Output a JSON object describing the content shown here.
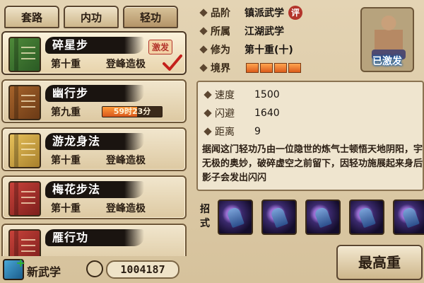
{
  "tabs": [
    {
      "label": "套路"
    },
    {
      "label": "内功"
    },
    {
      "label": "轻功"
    }
  ],
  "skills": [
    {
      "name": "碎星步",
      "level": "第十重",
      "grade": "登峰造极",
      "badge": "激发",
      "selected": true,
      "checked": true,
      "book_color": "green"
    },
    {
      "name": "幽行步",
      "level": "第九重",
      "progress_text": "59时23分",
      "progress_fraction": 0.58,
      "book_color": "brown"
    },
    {
      "name": "游龙身法",
      "level": "第十重",
      "grade": "登峰造极",
      "book_color": "yellow"
    },
    {
      "name": "梅花步法",
      "level": "第十重",
      "grade": "登峰造极",
      "book_color": "red"
    },
    {
      "name": "雁行功",
      "book_color": "red"
    }
  ],
  "bottom": {
    "new_label": "新武学",
    "currency": "1004187"
  },
  "details": {
    "rank_label": "品阶",
    "rank_value": "镇派武学",
    "rank_ping": "评",
    "origin_label": "所属",
    "origin_value": "江湖武学",
    "cultivation_label": "修为",
    "cultivation_value": "第十重(十)",
    "realm_label": "境界",
    "realm_segments": 4,
    "portrait_label": "已激发"
  },
  "stats": {
    "speed_label": "速度",
    "speed_value": "1500",
    "dodge_label": "闪避",
    "dodge_value": "1640",
    "distance_label": "距离",
    "distance_value": "9",
    "description": "据闻这门轻功乃由一位隐世的炼气士顿悟天地阴阳，宇宙无极的奥妙，破碎虚空之前留下，因轻功施展起来身后的影子会发出闪闪"
  },
  "moves": {
    "label": "招式",
    "count": 5
  },
  "max_button": "最高重"
}
